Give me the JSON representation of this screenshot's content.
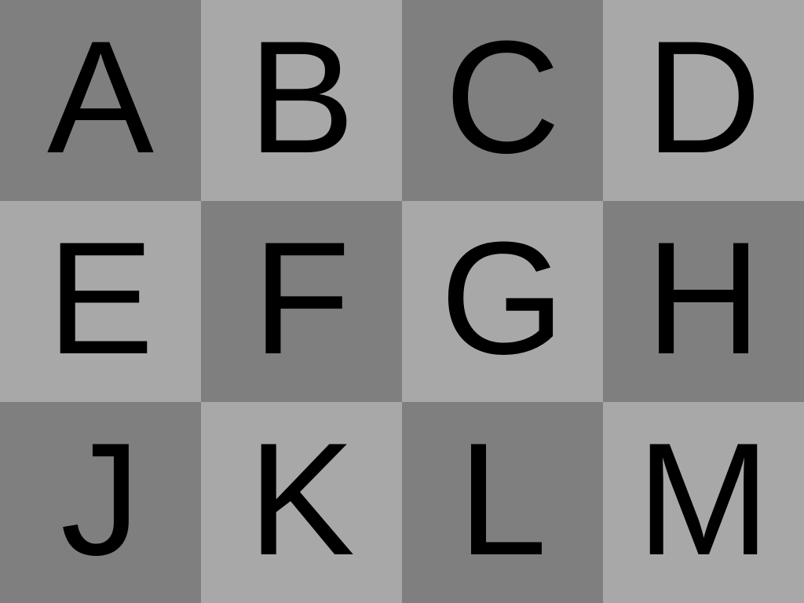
{
  "tiles": [
    {
      "letter": "A",
      "shade": "dark"
    },
    {
      "letter": "B",
      "shade": "light"
    },
    {
      "letter": "C",
      "shade": "dark"
    },
    {
      "letter": "D",
      "shade": "light"
    },
    {
      "letter": "E",
      "shade": "light"
    },
    {
      "letter": "F",
      "shade": "dark"
    },
    {
      "letter": "G",
      "shade": "light"
    },
    {
      "letter": "H",
      "shade": "dark"
    },
    {
      "letter": "J",
      "shade": "dark"
    },
    {
      "letter": "K",
      "shade": "light"
    },
    {
      "letter": "L",
      "shade": "dark"
    },
    {
      "letter": "M",
      "shade": "light"
    }
  ],
  "colors": {
    "dark": "#7f7f7f",
    "light": "#a8a8a8",
    "text": "#000000"
  }
}
